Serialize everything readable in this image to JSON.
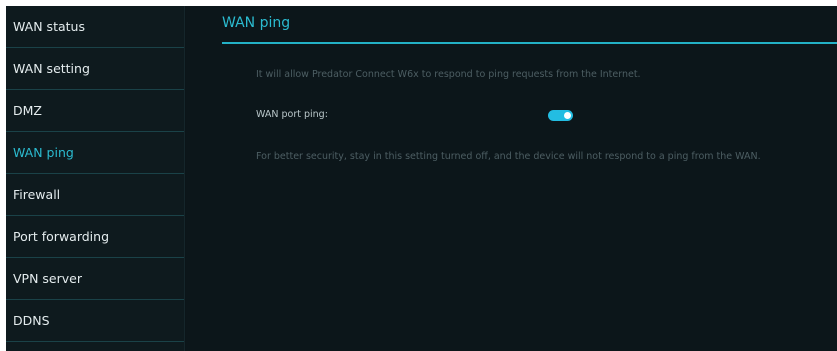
{
  "sidebar": {
    "items": [
      {
        "label": "WAN status"
      },
      {
        "label": "WAN setting"
      },
      {
        "label": "DMZ"
      },
      {
        "label": "WAN ping"
      },
      {
        "label": "Firewall"
      },
      {
        "label": "Port forwarding"
      },
      {
        "label": "VPN server"
      },
      {
        "label": "DDNS"
      }
    ],
    "active_index": 3
  },
  "main": {
    "title": "WAN ping",
    "description": "It will allow Predator Connect W6x to respond to ping requests from the Internet.",
    "setting": {
      "label": "WAN port ping:",
      "enabled": true
    },
    "note": "For better security, stay in this setting turned off, and the device will not respond to a ping from the WAN."
  },
  "colors": {
    "accent": "#2bbbd0",
    "toggle_on": "#23bde2",
    "background": "#0b1519"
  }
}
